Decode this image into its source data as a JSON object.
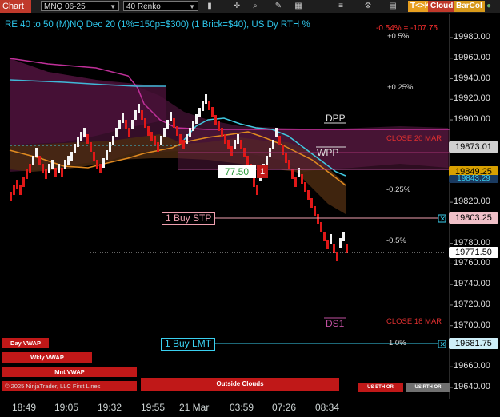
{
  "toolbar": {
    "chart_tab": "Chart",
    "instrument": "MNQ 06-25",
    "bar_type": "40 Renko",
    "tool_icons": [
      "bar-icon",
      "crosshair-icon",
      "zoom-icon",
      "drawing-icon",
      "strategy-icon",
      "dom-icon",
      "properties-icon",
      "template-icon"
    ],
    "tok_label": "T<>K",
    "cloud_label": "Cloud",
    "barcol_label": "BarCol",
    "colors": {
      "tok": "#e8a020",
      "cloud": "#c0392b",
      "barcol": "#d89a1a"
    }
  },
  "header": {
    "title": "RE 40 to 50 (M)NQ Dec 20 (1%=150p=$300) (1 Brick=$40), US Dy RTH %",
    "change": "-0.54% = -107.75"
  },
  "price_axis": {
    "labels": [
      "19980.00",
      "19960.00",
      "19940.00",
      "19920.00",
      "19900.00",
      "19820.00",
      "19780.00",
      "19760.00",
      "19740.00",
      "19720.00",
      "19700.00",
      "19660.00",
      "19640.00"
    ]
  },
  "price_boxes": {
    "dpp": "19873.01",
    "wpp": "19849.25",
    "hidden": "19843.29",
    "buy_stp": "19803.25",
    "last": "19771.50",
    "buy_lmt": "19681.75"
  },
  "chart_labels": {
    "plus_05": "+0.5%",
    "plus_025": "+0.25%",
    "minus_025": "-0.25%",
    "minus_05": "-0.5%",
    "plus_10": "1.0%",
    "dpp": "DPP",
    "wpp": "WPP",
    "ds1": "DS1",
    "close_20": "CLOSE 20 MAR",
    "close_18": "CLOSE 18 MAR"
  },
  "orders": {
    "buy_stp": "1 Buy STP",
    "buy_lmt": "1 Buy LMT",
    "position_value": "77.50",
    "position_qty": "1"
  },
  "legend": {
    "day_vwap": "Day VWAP",
    "wkly_vwap": "Wkly VWAP",
    "mnt_vwap": "Mnt VWAP",
    "copyright": "© 2025 NinjaTrader, LLC",
    "outside_clouds": "Outside Clouds",
    "us_eth_or": "US ETH OR",
    "us_rth_or": "US RTH OR",
    "first_lines": "First Lines"
  },
  "time_axis": [
    "18:49",
    "19:05",
    "19:32",
    "19:55",
    "21 Mar",
    "03:59",
    "07:26",
    "08:34"
  ],
  "chart_data": {
    "type": "renko",
    "brick_size": 40,
    "ylim": [
      19640,
      19990
    ],
    "y_ticks": [
      19640,
      19660,
      19700,
      19720,
      19740,
      19760,
      19780,
      19820,
      19900,
      19920,
      19940,
      19960,
      19980
    ],
    "levels": {
      "dpp": 19873.01,
      "wpp": 19849.25,
      "hidden": 19843.29,
      "buy_stp": 19803.25,
      "last": 19771.5,
      "buy_lmt": 19681.75
    },
    "x_ticks": [
      "18:49",
      "19:05",
      "19:32",
      "19:55",
      "21 Mar",
      "03:59",
      "07:26",
      "08:34"
    ]
  }
}
